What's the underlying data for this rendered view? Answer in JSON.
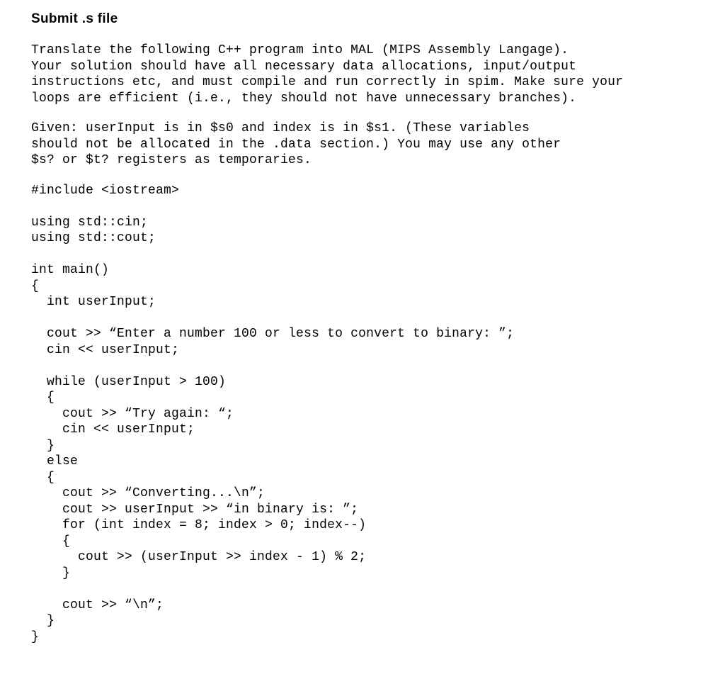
{
  "title": "Submit .s file",
  "para1_l1": "Translate the following C++ program into MAL (MIPS Assembly Langage).",
  "para1_l2": "Your solution should have all necessary data allocations, input/output",
  "para1_l3": "instructions etc, and must compile and run correctly in spim. Make sure your",
  "para1_l4": "loops are efficient (i.e., they should not have unnecessary branches).",
  "para2_l1": "Given: userInput is in $s0 and index is in $s1. (These variables",
  "para2_l2": "should not be allocated in the .data section.) You may use any other",
  "para2_l3": "$s? or $t? registers as temporaries.",
  "code": {
    "l01": "#include <iostream>",
    "l02": "",
    "l03": "using std::cin;",
    "l04": "using std::cout;",
    "l05": "",
    "l06": "int main()",
    "l07": "{",
    "l08": "  int userInput;",
    "l09": "",
    "l10": "  cout >> “Enter a number 100 or less to convert to binary: ”;",
    "l11": "  cin << userInput;",
    "l12": "",
    "l13": "  while (userInput > 100)",
    "l14": "  {",
    "l15": "    cout >> “Try again: “;",
    "l16": "    cin << userInput;",
    "l17": "  }",
    "l18": "  else",
    "l19": "  {",
    "l20": "    cout >> “Converting...\\n”;",
    "l21": "    cout >> userInput >> “in binary is: ”;",
    "l22": "    for (int index = 8; index > 0; index--)",
    "l23": "    {",
    "l24": "      cout >> (userInput >> index - 1) % 2;",
    "l25": "    }",
    "l26": "",
    "l27": "    cout >> “\\n”;",
    "l28": "  }",
    "l29": "}"
  }
}
